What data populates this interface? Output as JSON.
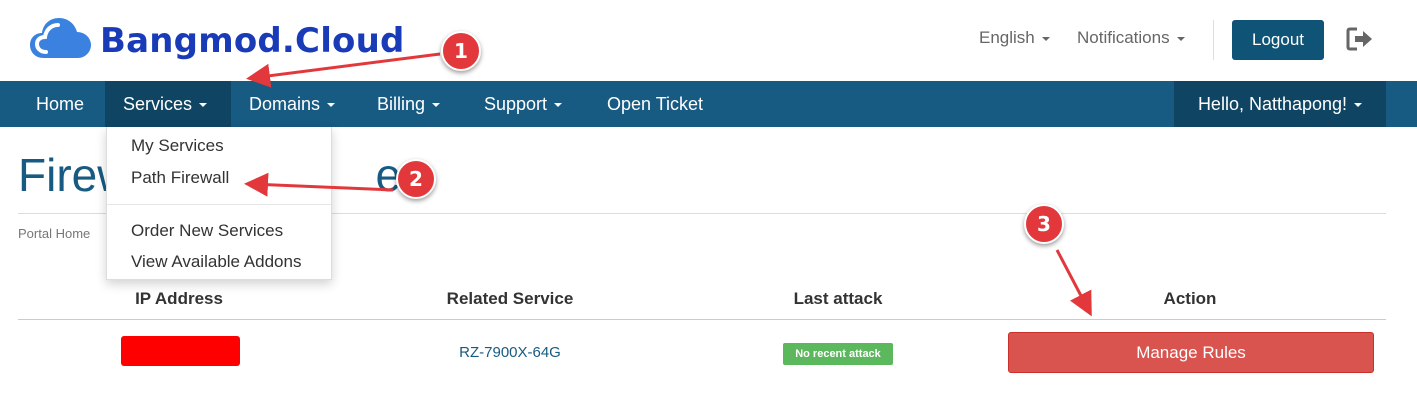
{
  "header": {
    "brand": "Bangmod.Cloud",
    "language_label": "English",
    "notifications_label": "Notifications",
    "logout_label": "Logout",
    "logout_icon": "sign-out-icon",
    "logo_icon": "cloud-icon"
  },
  "nav": {
    "items": [
      {
        "label": "Home"
      },
      {
        "label": "Services"
      },
      {
        "label": "Domains"
      },
      {
        "label": "Billing"
      },
      {
        "label": "Support"
      },
      {
        "label": "Open Ticket"
      }
    ],
    "user_label": "Hello, Natthapong!",
    "active": "Services"
  },
  "dropdown": {
    "items": [
      {
        "label": "My Services"
      },
      {
        "label": "Path Firewall"
      },
      {
        "label": "Order New Services"
      },
      {
        "label": "View Available Addons"
      }
    ]
  },
  "page": {
    "title_visible": "Firew",
    "title_tail": "er",
    "breadcrumb": "Portal Home"
  },
  "table": {
    "headers": [
      "IP Address",
      "Related Service",
      "Last attack",
      "Action"
    ],
    "rows": [
      {
        "ip": "",
        "service": "RZ-7900X-64G",
        "last_attack": "No recent attack",
        "action": "Manage Rules"
      }
    ]
  },
  "annotations": [
    "1",
    "2",
    "3"
  ],
  "colors": {
    "brand_blue": "#1a3bb8",
    "navbar": "#175a82",
    "navbar_active": "#0f4563",
    "logout_button": "#0f5376",
    "danger": "#d9534f",
    "success": "#5cb85c",
    "annotation_red": "#e2383c",
    "redaction": "#ff0000"
  }
}
